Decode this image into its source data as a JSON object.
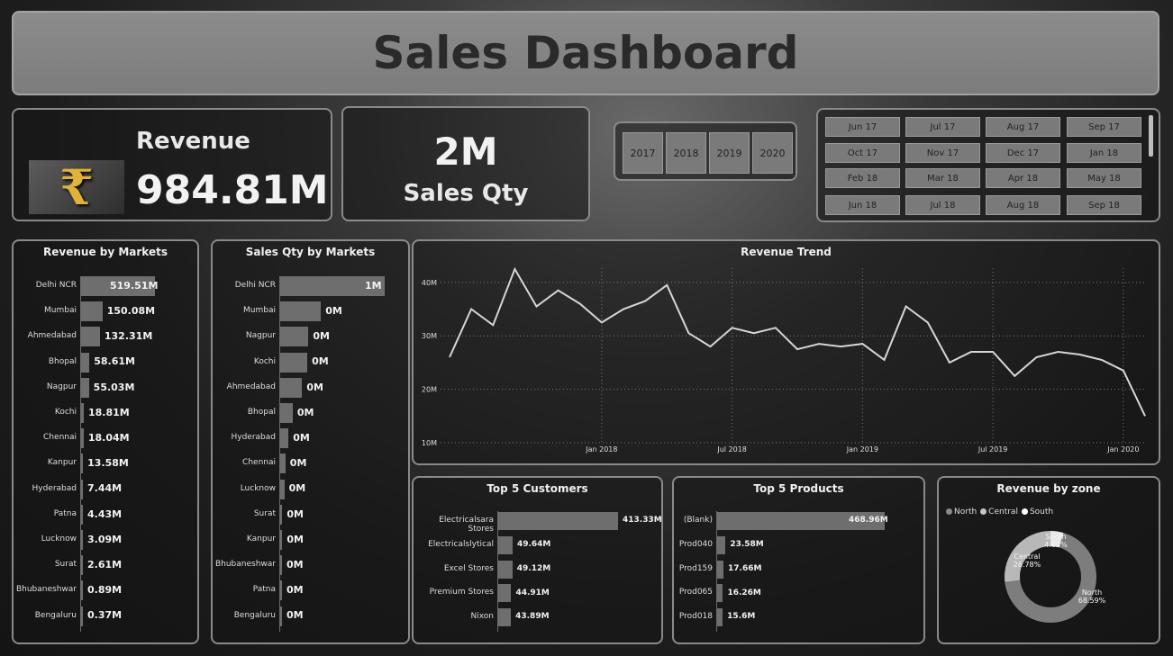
{
  "title": "Sales Dashboard",
  "kpi": {
    "revenue_label": "Revenue",
    "revenue_value": "984.81M",
    "rupee_symbol": "₹",
    "qty_value": "2M",
    "qty_label": "Sales Qty"
  },
  "years": [
    "2017",
    "2018",
    "2019",
    "2020"
  ],
  "months": [
    "Jun 17",
    "Jul 17",
    "Aug 17",
    "Sep 17",
    "Oct 17",
    "Nov 17",
    "Dec 17",
    "Jan 18",
    "Feb 18",
    "Mar 18",
    "Apr 18",
    "May 18",
    "Jun 18",
    "Jul 18",
    "Aug 18",
    "Sep 18"
  ],
  "revenue_by_markets": {
    "title": "Revenue by Markets",
    "rows": [
      {
        "cat": "Delhi NCR",
        "value": 519.51,
        "label": "519.51M"
      },
      {
        "cat": "Mumbai",
        "value": 150.08,
        "label": "150.08M"
      },
      {
        "cat": "Ahmedabad",
        "value": 132.31,
        "label": "132.31M"
      },
      {
        "cat": "Bhopal",
        "value": 58.61,
        "label": "58.61M"
      },
      {
        "cat": "Nagpur",
        "value": 55.03,
        "label": "55.03M"
      },
      {
        "cat": "Kochi",
        "value": 18.81,
        "label": "18.81M"
      },
      {
        "cat": "Chennai",
        "value": 18.04,
        "label": "18.04M"
      },
      {
        "cat": "Kanpur",
        "value": 13.58,
        "label": "13.58M"
      },
      {
        "cat": "Hyderabad",
        "value": 7.44,
        "label": "7.44M"
      },
      {
        "cat": "Patna",
        "value": 4.43,
        "label": "4.43M"
      },
      {
        "cat": "Lucknow",
        "value": 3.09,
        "label": "3.09M"
      },
      {
        "cat": "Surat",
        "value": 2.61,
        "label": "2.61M"
      },
      {
        "cat": "Bhubaneshwar",
        "value": 0.89,
        "label": "0.89M"
      },
      {
        "cat": "Bengaluru",
        "value": 0.37,
        "label": "0.37M"
      }
    ]
  },
  "sales_qty_by_markets": {
    "title": "Sales Qty by Markets",
    "rows": [
      {
        "cat": "Delhi NCR",
        "value": 1.0,
        "label": "1M"
      },
      {
        "cat": "Mumbai",
        "value": 0.39,
        "label": "0M"
      },
      {
        "cat": "Nagpur",
        "value": 0.27,
        "label": "0M"
      },
      {
        "cat": "Kochi",
        "value": 0.26,
        "label": "0M"
      },
      {
        "cat": "Ahmedabad",
        "value": 0.21,
        "label": "0M"
      },
      {
        "cat": "Bhopal",
        "value": 0.12,
        "label": "0M"
      },
      {
        "cat": "Hyderabad",
        "value": 0.08,
        "label": "0M"
      },
      {
        "cat": "Chennai",
        "value": 0.05,
        "label": "0M"
      },
      {
        "cat": "Lucknow",
        "value": 0.04,
        "label": "0M"
      },
      {
        "cat": "Surat",
        "value": 0.02,
        "label": "0M"
      },
      {
        "cat": "Kanpur",
        "value": 0.02,
        "label": "0M"
      },
      {
        "cat": "Bhubaneshwar",
        "value": 0.015,
        "label": "0M"
      },
      {
        "cat": "Patna",
        "value": 0.01,
        "label": "0M"
      },
      {
        "cat": "Bengaluru",
        "value": 0.005,
        "label": "0M"
      }
    ]
  },
  "revenue_trend": {
    "title": "Revenue Trend",
    "y_ticks": [
      {
        "v": 10,
        "label": "10M"
      },
      {
        "v": 20,
        "label": "20M"
      },
      {
        "v": 30,
        "label": "30M"
      },
      {
        "v": 40,
        "label": "40M"
      }
    ],
    "x_ticks": [
      {
        "i": 7,
        "label": "Jan 2018"
      },
      {
        "i": 13,
        "label": "Jul 2018"
      },
      {
        "i": 19,
        "label": "Jan 2019"
      },
      {
        "i": 25,
        "label": "Jul 2019"
      },
      {
        "i": 31,
        "label": "Jan 2020"
      }
    ]
  },
  "top_customers": {
    "title": "Top 5 Customers",
    "rows": [
      {
        "cat": "Electricalsara Stores",
        "value": 413.33,
        "label": "413.33M"
      },
      {
        "cat": "Electricalslytical",
        "value": 49.64,
        "label": "49.64M"
      },
      {
        "cat": "Excel Stores",
        "value": 49.12,
        "label": "49.12M"
      },
      {
        "cat": "Premium Stores",
        "value": 44.91,
        "label": "44.91M"
      },
      {
        "cat": "Nixon",
        "value": 43.89,
        "label": "43.89M"
      }
    ]
  },
  "top_products": {
    "title": "Top 5 Products",
    "rows": [
      {
        "cat": "(Blank)",
        "value": 468.96,
        "label": "468.96M"
      },
      {
        "cat": "Prod040",
        "value": 23.58,
        "label": "23.58M"
      },
      {
        "cat": "Prod159",
        "value": 17.66,
        "label": "17.66M"
      },
      {
        "cat": "Prod065",
        "value": 16.26,
        "label": "16.26M"
      },
      {
        "cat": "Prod018",
        "value": 15.6,
        "label": "15.6M"
      }
    ]
  },
  "revenue_by_zone": {
    "title": "Revenue by zone",
    "legend": [
      {
        "name": "North",
        "color": "#8a8a8a"
      },
      {
        "name": "Central",
        "color": "#c4c4c4"
      },
      {
        "name": "South",
        "color": "#ffffff"
      }
    ],
    "slices": [
      {
        "name": "North",
        "pct": 68.59,
        "pct_label": "68.59%",
        "color": "#7d7d7d"
      },
      {
        "name": "Central",
        "pct": 26.78,
        "pct_label": "26.78%",
        "color": "#b8b8b8"
      },
      {
        "name": "South",
        "pct": 4.63,
        "pct_label": "4.63%",
        "color": "#e8e8e8"
      }
    ]
  },
  "chart_data": {
    "type": "line",
    "title": "Revenue Trend",
    "xlabel": "",
    "ylabel": "",
    "ylim": [
      10,
      43
    ],
    "x": [
      "Oct 2017",
      "Nov 2017",
      "Dec 2017",
      "Jan 2018",
      "Feb 2018",
      "Mar 2018",
      "Apr 2018",
      "May 2018",
      "Jun 2018",
      "Jul 2018",
      "Aug 2018",
      "Sep 2018",
      "Oct 2018",
      "Nov 2018",
      "Dec 2018",
      "Jan 2019",
      "Feb 2019",
      "Mar 2019",
      "Apr 2019",
      "May 2019",
      "Jun 2019",
      "Jul 2019",
      "Aug 2019",
      "Sep 2019",
      "Oct 2019",
      "Nov 2019",
      "Dec 2019",
      "Jan 2020",
      "Feb 2020",
      "Mar 2020",
      "Apr 2020",
      "May 2020",
      "Jun 2020"
    ],
    "series": [
      {
        "values": [
          26,
          35,
          32,
          42.5,
          35.5,
          38.5,
          36,
          32.5,
          35,
          36.5,
          39.5,
          30.5,
          28,
          31.5,
          30.5,
          31.5,
          27.5,
          28.5,
          28,
          28.5,
          25.5,
          35.5,
          32.5,
          25,
          27,
          27,
          22.5,
          26,
          27,
          26.5,
          25.5,
          23.5,
          15
        ]
      }
    ]
  }
}
